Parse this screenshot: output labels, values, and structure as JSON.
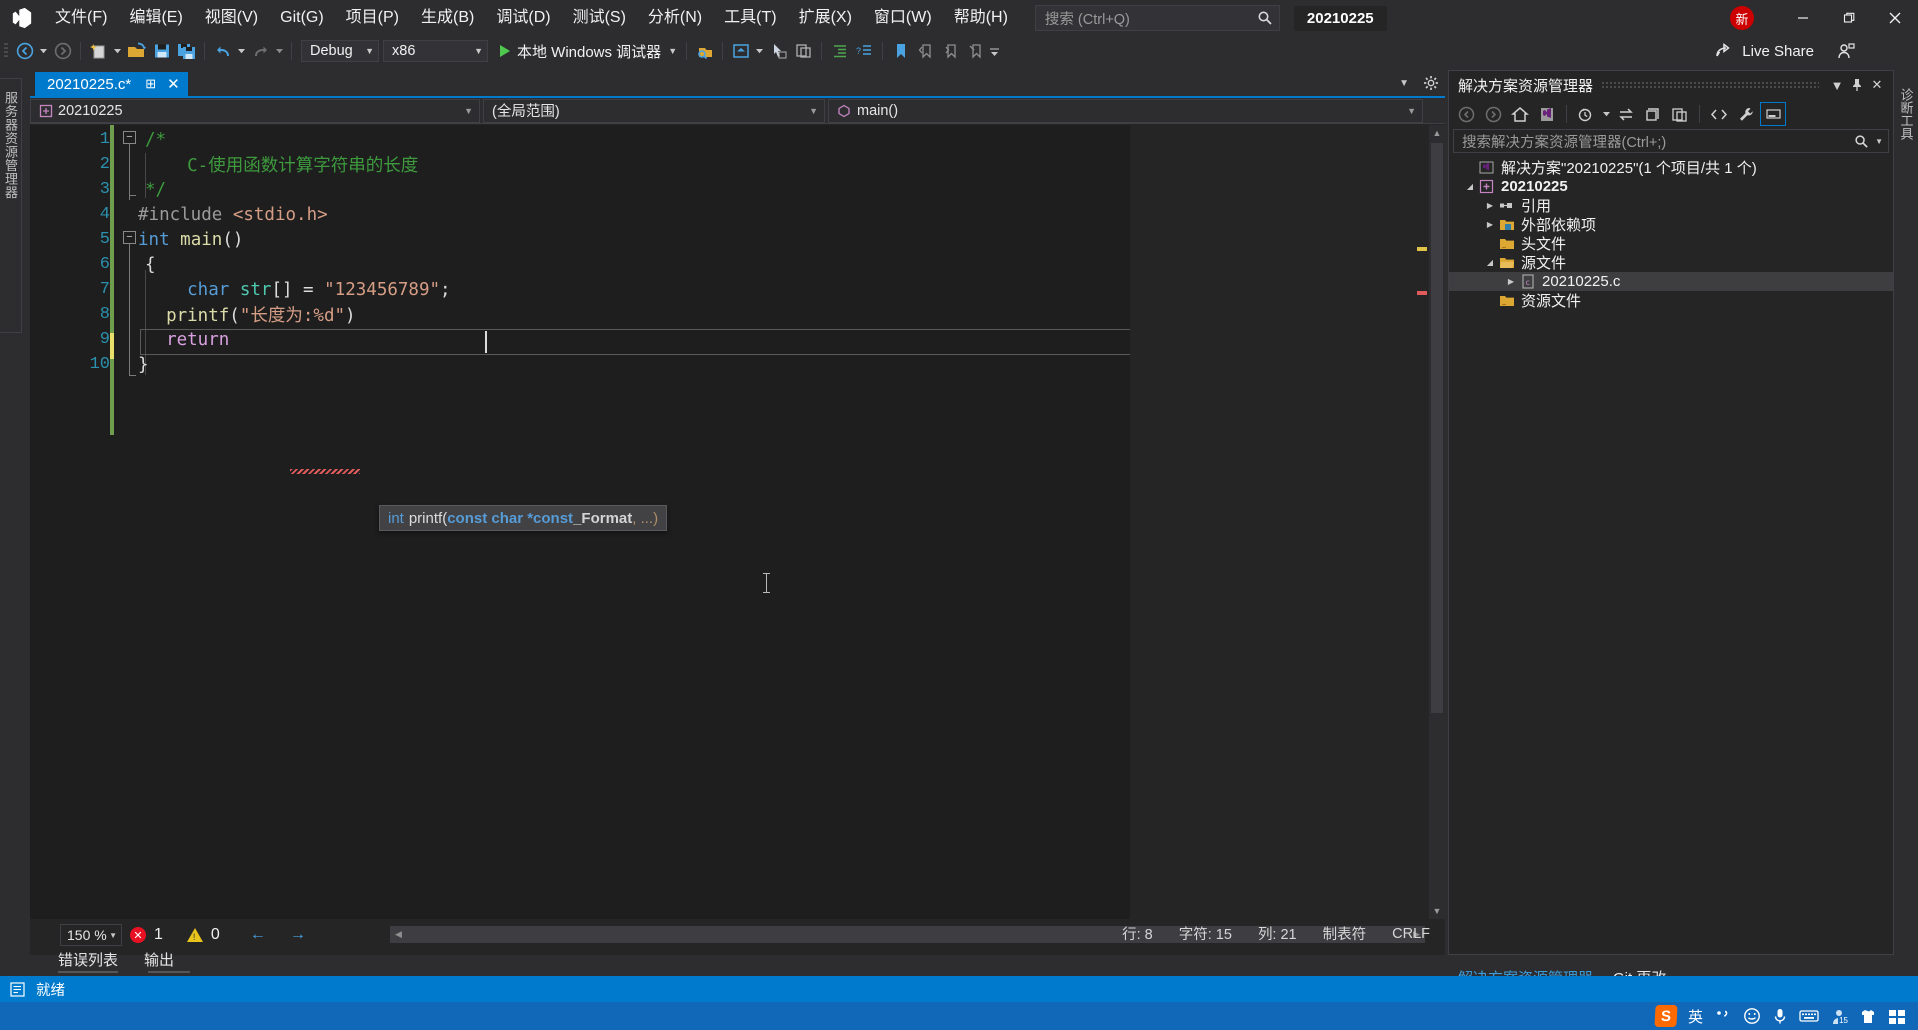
{
  "titlebar": {
    "menus": [
      "文件(F)",
      "编辑(E)",
      "视图(V)",
      "Git(G)",
      "项目(P)",
      "生成(B)",
      "调试(D)",
      "测试(S)",
      "分析(N)",
      "工具(T)",
      "扩展(X)",
      "窗口(W)",
      "帮助(H)"
    ],
    "search_placeholder": "搜索 (Ctrl+Q)",
    "project_badge": "20210225",
    "new_badge": "新",
    "minimize": "—",
    "maximize": "❐",
    "close": "✕"
  },
  "toolbar": {
    "config": "Debug",
    "platform": "x86",
    "run_label": "本地 Windows 调试器",
    "live_share": "Live Share"
  },
  "left_rail": {
    "label": "服务器资源管理器"
  },
  "right_rail": {
    "label": "诊断工具"
  },
  "editor": {
    "tab_title": "20210225.c*",
    "tab_pin": "⊟",
    "tab_close": "✕",
    "nav_project": "20210225",
    "nav_scope": "(全局范围)",
    "nav_member": "main()",
    "lines": [
      {
        "n": "1",
        "tokens": [
          {
            "t": "/*",
            "c": "cm"
          }
        ]
      },
      {
        "n": "2",
        "tokens": [
          {
            "t": "    C-使用函数计算字符串的长度",
            "c": "cm"
          }
        ]
      },
      {
        "n": "3",
        "tokens": [
          {
            "t": "*/",
            "c": "cm"
          }
        ]
      },
      {
        "n": "4",
        "tokens": [
          {
            "t": "#include ",
            "c": "pp"
          },
          {
            "t": "<stdio.h>",
            "c": "str"
          }
        ]
      },
      {
        "n": "5",
        "tokens": [
          {
            "t": "int",
            "c": "ty"
          },
          {
            "t": " ",
            "c": "pun"
          },
          {
            "t": "main",
            "c": "fn"
          },
          {
            "t": "()",
            "c": "pun"
          }
        ]
      },
      {
        "n": "6",
        "tokens": [
          {
            "t": "{",
            "c": "pun"
          }
        ]
      },
      {
        "n": "7",
        "tokens": [
          {
            "t": "    char",
            "c": "ty"
          },
          {
            "t": " ",
            "c": "pun"
          },
          {
            "t": "str",
            "c": "kw2"
          },
          {
            "t": "[] = ",
            "c": "pun"
          },
          {
            "t": "\"123456789\"",
            "c": "str"
          },
          {
            "t": ";",
            "c": "pun"
          }
        ]
      },
      {
        "n": "8",
        "tokens": [
          {
            "t": "  printf",
            "c": "fn"
          },
          {
            "t": "(",
            "c": "pun"
          },
          {
            "t": "\"长度为:%d\"",
            "c": "str"
          },
          {
            "t": ")",
            "c": "pun"
          }
        ]
      },
      {
        "n": "9",
        "tokens": [
          {
            "t": "  return",
            "c": "kwr"
          }
        ]
      },
      {
        "n": "10",
        "tokens": [
          {
            "t": "}",
            "c": "pun"
          }
        ]
      }
    ],
    "tooltip": {
      "ret": "int",
      "name": " printf(",
      "params": "const char *const",
      "fmt": " _Format",
      "dots": ", ...)"
    },
    "zoom": "150 %",
    "error_count": "1",
    "warning_count": "0",
    "row_label": "行: 8",
    "char_label": "字符: 15",
    "col_label": "列: 21",
    "tab_mode": "制表符",
    "eol": "CRLF",
    "panel_tabs": [
      "错误列表",
      "输出"
    ]
  },
  "solution_explorer": {
    "title": "解决方案资源管理器",
    "search_placeholder": "搜索解决方案资源管理器(Ctrl+;)",
    "tree": [
      {
        "label": "解决方案\"20210225\"(1 个项目/共 1 个)",
        "indent": 0,
        "expander": "",
        "icon": "solution-icon",
        "bold": false,
        "selected": false
      },
      {
        "label": "20210225",
        "indent": 1,
        "expander": "▲",
        "icon": "project-icon",
        "bold": true,
        "selected": false
      },
      {
        "label": "引用",
        "indent": 2,
        "expander": "▶",
        "icon": "references-icon",
        "bold": false,
        "selected": false
      },
      {
        "label": "外部依赖项",
        "indent": 2,
        "expander": "▶",
        "icon": "ext-deps-icon",
        "bold": false,
        "selected": false
      },
      {
        "label": "头文件",
        "indent": 2,
        "expander": "",
        "icon": "folder-icon",
        "bold": false,
        "selected": false
      },
      {
        "label": "源文件",
        "indent": 2,
        "expander": "▲",
        "icon": "folder-open-icon",
        "bold": false,
        "selected": false
      },
      {
        "label": "20210225.c",
        "indent": 3,
        "expander": "▶",
        "icon": "c-file-icon",
        "bold": false,
        "selected": true
      },
      {
        "label": "资源文件",
        "indent": 2,
        "expander": "",
        "icon": "folder-icon",
        "bold": false,
        "selected": false
      }
    ],
    "bottom_tabs": [
      {
        "label": "解决方案资源管理器",
        "active": true
      },
      {
        "label": "Git 更改",
        "active": false
      }
    ]
  },
  "status_bar": {
    "text": "就绪"
  },
  "taskbar": {
    "ime_lang": "英",
    "ime_badge": "15"
  },
  "colors": {
    "accent": "#007acc",
    "titlebar_bg": "#2d2d30",
    "editor_bg": "#1e1e1e",
    "comment_green": "#3d9a3d",
    "string_orange": "#d69d85",
    "keyword_blue": "#569cd6",
    "error_red": "#e81123",
    "warning_yellow": "#e8c41c"
  }
}
